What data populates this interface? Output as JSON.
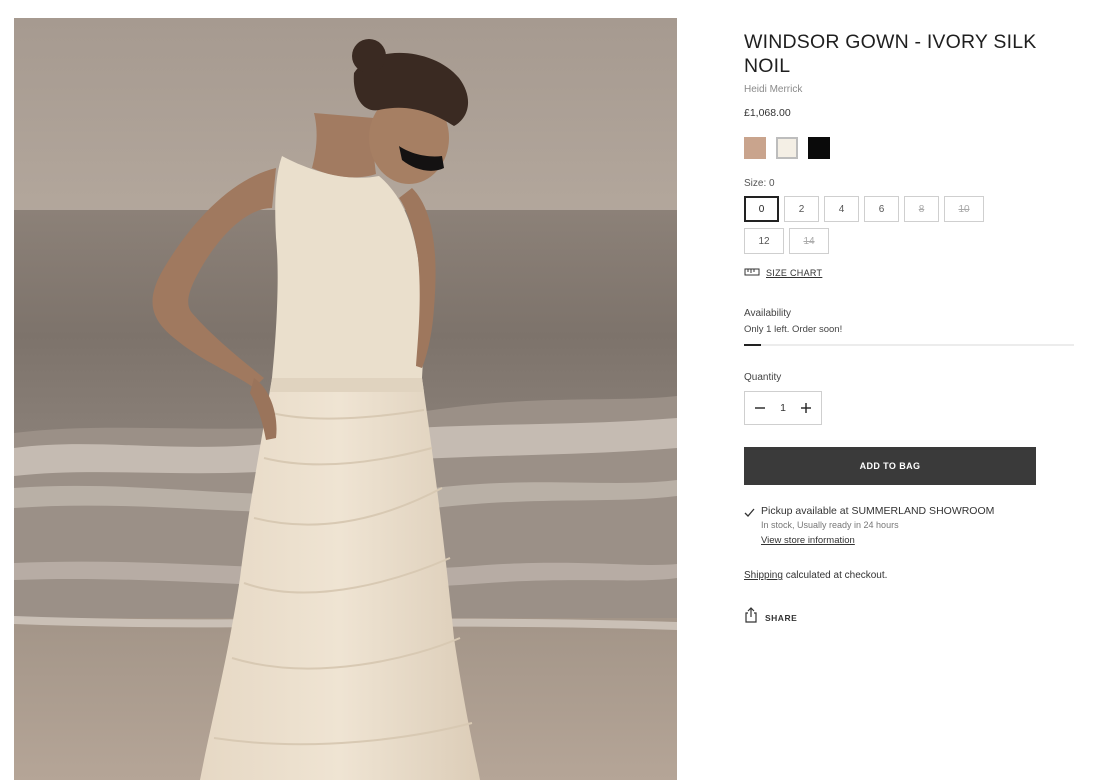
{
  "product": {
    "title": "WINDSOR GOWN - IVORY SILK NOIL",
    "vendor": "Heidi Merrick",
    "price": "£1,068.00",
    "image_icon": "product-photo"
  },
  "colors": [
    {
      "name": "sand",
      "hex": "#c9a48d"
    },
    {
      "name": "ivory",
      "hex": "#f4efe5",
      "selected": true
    },
    {
      "name": "black",
      "hex": "#0a0a0a"
    }
  ],
  "size": {
    "label": "Size: 0",
    "options": [
      {
        "label": "0",
        "state": "selected"
      },
      {
        "label": "2",
        "state": "available"
      },
      {
        "label": "4",
        "state": "available"
      },
      {
        "label": "6",
        "state": "available"
      },
      {
        "label": "8",
        "state": "soldout"
      },
      {
        "label": "10",
        "state": "soldout"
      },
      {
        "label": "12",
        "state": "available"
      },
      {
        "label": "14",
        "state": "soldout"
      }
    ],
    "chart_label": "SIZE CHART",
    "chart_icon": "ruler-icon"
  },
  "availability": {
    "label": "Availability",
    "text": "Only 1 left. Order soon!",
    "stock_level": 0.05
  },
  "quantity": {
    "label": "Quantity",
    "value": "1",
    "minus_icon": "minus-icon",
    "plus_icon": "plus-icon"
  },
  "add_to_bag": "ADD TO BAG",
  "pickup": {
    "icon": "check-icon",
    "main": "Pickup available at SUMMERLAND SHOWROOM",
    "sub": "In stock, Usually ready in 24 hours",
    "link": "View store information"
  },
  "shipping": {
    "link": "Shipping",
    "text": " calculated at checkout."
  },
  "share": {
    "icon": "share-icon",
    "label": "SHARE"
  },
  "colors_theme": {
    "button_bg": "#3a3a3a",
    "border": "#cfcfcf"
  }
}
